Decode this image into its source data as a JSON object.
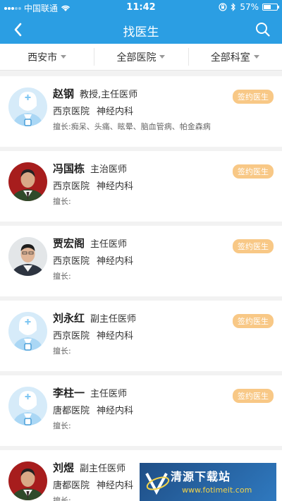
{
  "status_bar": {
    "carrier": "中国联通",
    "time": "11:42",
    "battery": "57%",
    "battery_level": 0.57
  },
  "nav": {
    "title": "找医生"
  },
  "filters": [
    {
      "label": "西安市"
    },
    {
      "label": "全部医院"
    },
    {
      "label": "全部科室"
    }
  ],
  "sign_label": "签约医生",
  "doctors": [
    {
      "name": "赵钢",
      "title": "教授,主任医师",
      "hospital": "西京医院",
      "dept": "神经内科",
      "skill": "擅长:痴呆、头痛、眩晕、脑血管病、帕金森病",
      "avatar": "placeholder"
    },
    {
      "name": "冯国栋",
      "title": "主治医师",
      "hospital": "西京医院",
      "dept": "神经内科",
      "skill": "擅长:",
      "avatar": "photo-uniform"
    },
    {
      "name": "贾宏阁",
      "title": "主任医师",
      "hospital": "西京医院",
      "dept": "神经内科",
      "skill": "擅长:",
      "avatar": "photo-suit"
    },
    {
      "name": "刘永红",
      "title": "副主任医师",
      "hospital": "西京医院",
      "dept": "神经内科",
      "skill": "擅长:",
      "avatar": "placeholder"
    },
    {
      "name": "李柱一",
      "title": "主任医师",
      "hospital": "唐都医院",
      "dept": "神经内科",
      "skill": "擅长:",
      "avatar": "placeholder"
    },
    {
      "name": "刘煜",
      "title": "副主任医师",
      "hospital": "唐都医院",
      "dept": "神经内科",
      "skill": "擅长:",
      "avatar": "photo-uniform"
    }
  ],
  "watermark": {
    "main": "清源下载站",
    "sub": "www.fotimeit.com"
  }
}
